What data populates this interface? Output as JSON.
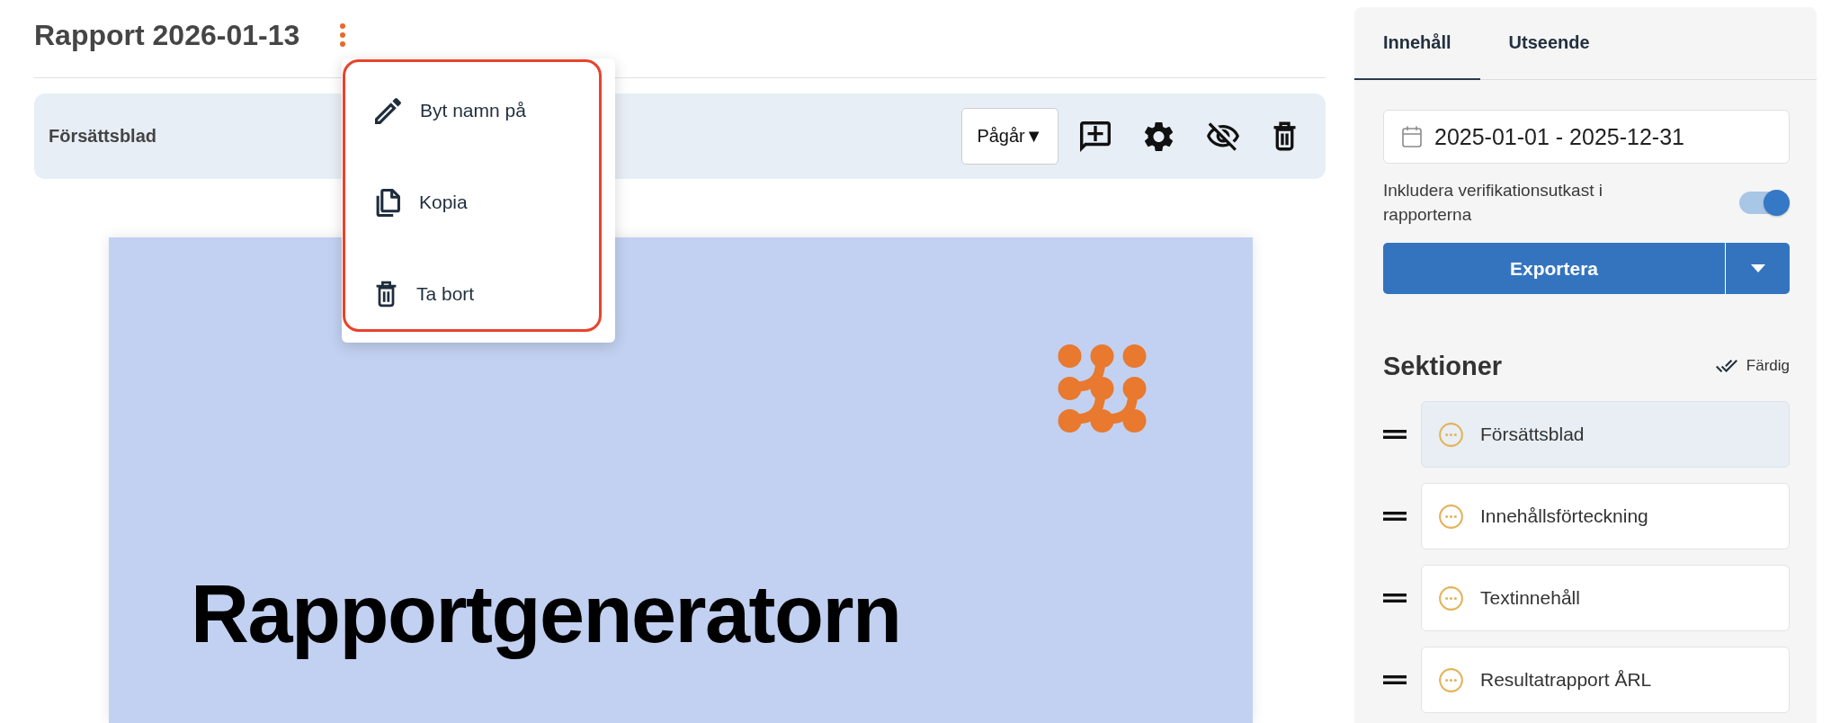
{
  "report": {
    "title": "Rapport 2026-01-13"
  },
  "context_menu": {
    "focused": true,
    "items": [
      {
        "label": "Byt namn på",
        "kind": "rename"
      },
      {
        "label": "Kopia",
        "kind": "copy"
      },
      {
        "label": "Ta bort",
        "kind": "delete"
      }
    ]
  },
  "section_toolbar": {
    "title": "Försättsblad",
    "status": {
      "label": "Pågår▼"
    },
    "actions": [
      {
        "kind": "comment"
      },
      {
        "kind": "settings"
      },
      {
        "kind": "hide"
      },
      {
        "kind": "delete"
      }
    ]
  },
  "cover": {
    "title": "Rapportgeneratorn"
  },
  "side_panel": {
    "tabs": [
      {
        "label": "Innehåll",
        "selected": true
      },
      {
        "label": "Utseende",
        "selected": false
      }
    ],
    "date_range": {
      "value": "2025-01-01 - 2025-12-31"
    },
    "draft_toggle": {
      "label": "Inkludera verifikationsutkast i rapporterna",
      "on": true
    },
    "export_button": {
      "label": "Exportera"
    },
    "sections": {
      "title": "Sektioner",
      "done_button": {
        "label": "Färdig"
      },
      "items": [
        {
          "label": "Försättsblad",
          "selected": true
        },
        {
          "label": "Innehållsförteckning",
          "selected": false
        },
        {
          "label": "Textinnehåll",
          "selected": false
        },
        {
          "label": "Resultatrapport ÅRL",
          "selected": false
        }
      ]
    }
  }
}
